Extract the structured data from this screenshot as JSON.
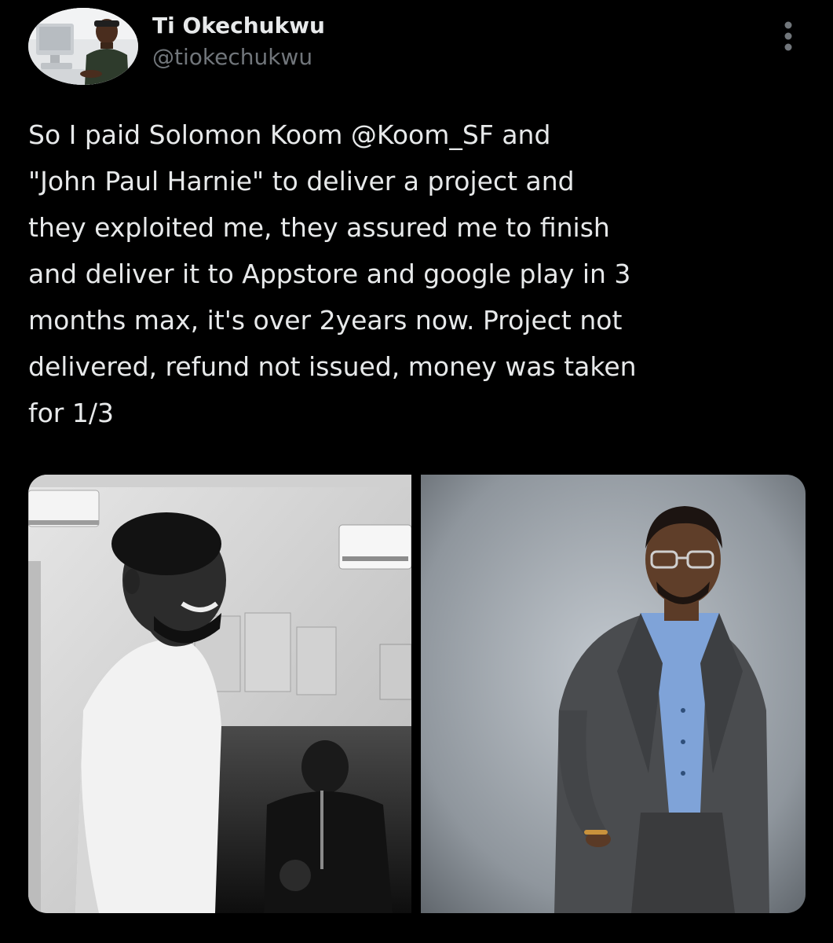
{
  "author": {
    "display_name": "Ti Okechukwu",
    "handle": "@tiokechukwu",
    "avatar_icon": "profile-photo"
  },
  "more_icon": "vertical-ellipsis-icon",
  "tweet": {
    "lines": [
      "So I paid Solomon Koom @Koom_SF and",
      "\"John Paul Harnie\" to deliver a project and",
      "they exploited me, they assured me to finish",
      "and deliver it to Appstore and google play in 3",
      "months max, it's over 2years now. Project not",
      "delivered, refund not issued, money was taken",
      "for 1/3"
    ]
  },
  "media": {
    "count": 2,
    "photos": [
      {
        "icon": "black-and-white-photo-smiling-man-white-tshirt"
      },
      {
        "icon": "color-photo-man-in-grey-suit-blue-shirt"
      }
    ]
  },
  "colors": {
    "background": "#000000",
    "text_primary": "#e7e9ea",
    "text_secondary": "#71767b"
  }
}
